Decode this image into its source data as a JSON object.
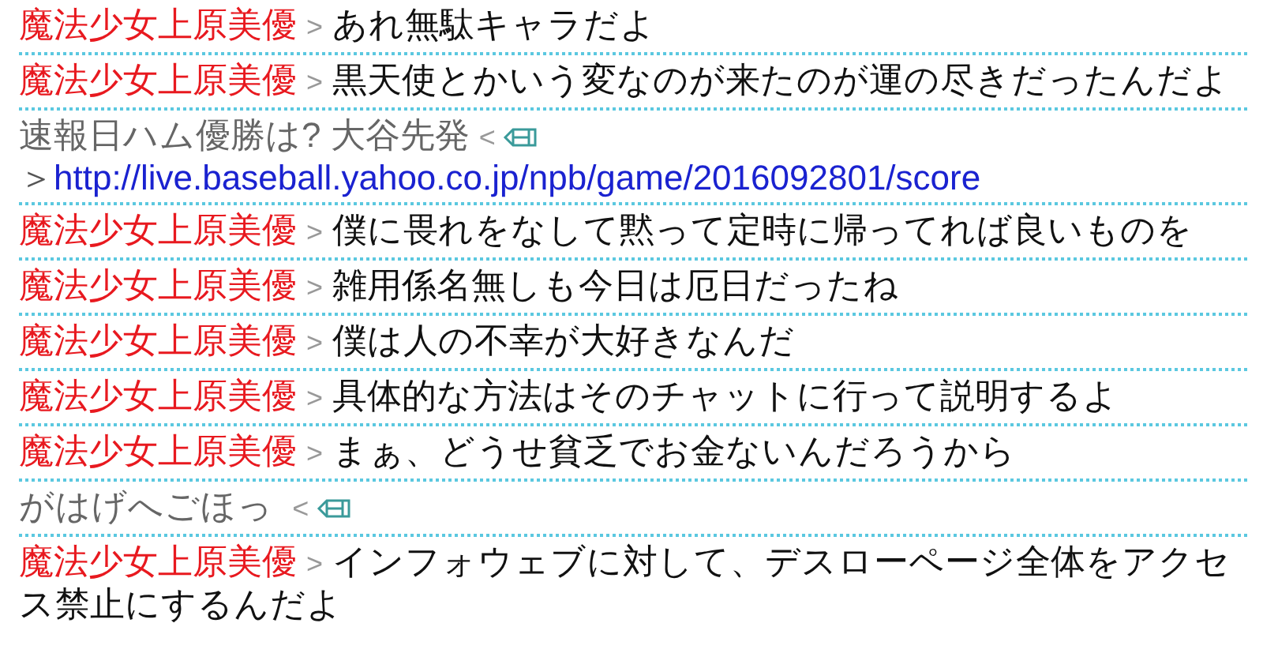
{
  "messages": [
    {
      "kind": "chat",
      "name": "魔法少女上原美優",
      "separator": ">",
      "text": "あれ無駄キャラだよ"
    },
    {
      "kind": "chat",
      "name": "魔法少女上原美優",
      "separator": ">",
      "text": "黒天使とかいう変なのが来たのが運の尽きだったんだよ"
    },
    {
      "kind": "system",
      "text": "速報日ハム優勝は? 大谷先発",
      "separator": "<",
      "link_prefix": "＞",
      "link": "http://live.baseball.yahoo.co.jp/npb/game/2016092801/score"
    },
    {
      "kind": "chat",
      "name": "魔法少女上原美優",
      "separator": ">",
      "text": "僕に畏れをなして黙って定時に帰ってれば良いものを"
    },
    {
      "kind": "chat",
      "name": "魔法少女上原美優",
      "separator": ">",
      "text": "雑用係名無しも今日は厄日だったね"
    },
    {
      "kind": "chat",
      "name": "魔法少女上原美優",
      "separator": ">",
      "text": "僕は人の不幸が大好きなんだ"
    },
    {
      "kind": "chat",
      "name": "魔法少女上原美優",
      "separator": ">",
      "text": "具体的な方法はそのチャットに行って説明するよ"
    },
    {
      "kind": "chat",
      "name": "魔法少女上原美優",
      "separator": ">",
      "text": "まぁ、どうせ貧乏でお金ないんだろうから"
    },
    {
      "kind": "system",
      "text": "がはげへごほっ ",
      "separator": "<"
    },
    {
      "kind": "chat",
      "name": "魔法少女上原美優",
      "separator": ">",
      "text": "インフォウェブに対して、デスローページ全体をアクセス禁止にするんだよ"
    }
  ]
}
